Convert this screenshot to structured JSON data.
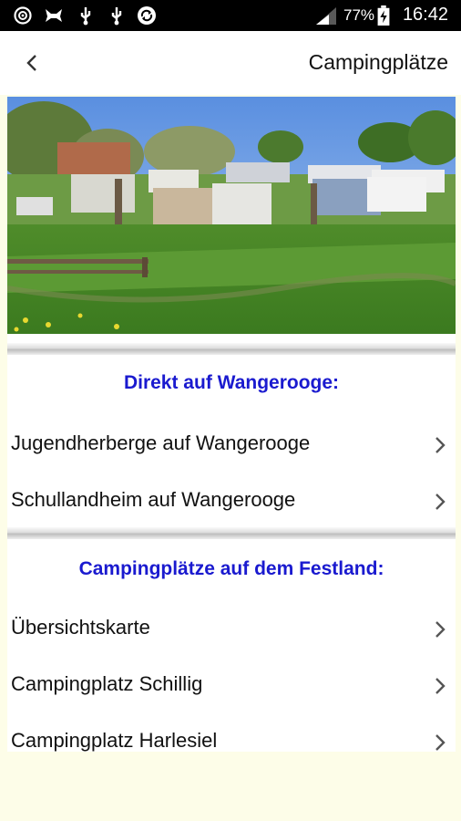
{
  "status_bar": {
    "icons": [
      "sync-icon",
      "cat-icon",
      "usb-icon",
      "usb-icon",
      "sync-circle-icon"
    ],
    "battery_percent": "77%",
    "time": "16:42"
  },
  "app_bar": {
    "title": "Campingplätze",
    "back_icon": "chevron-left-icon"
  },
  "hero_image": {
    "description_icon": "campsite-photo"
  },
  "sections": [
    {
      "heading": "Direkt auf Wangerooge:",
      "items": [
        {
          "label": "Jugendherberge auf Wangerooge"
        },
        {
          "label": "Schullandheim auf Wangerooge"
        }
      ]
    },
    {
      "heading": "Campingplätze auf dem Festland:",
      "items": [
        {
          "label": "Übersichtskarte"
        },
        {
          "label": "Campingplatz Schillig"
        },
        {
          "label": "Campingplatz Harlesiel"
        }
      ]
    }
  ],
  "colors": {
    "heading": "#1a1acf",
    "background": "#fdfde8",
    "status_bar": "#000000"
  }
}
